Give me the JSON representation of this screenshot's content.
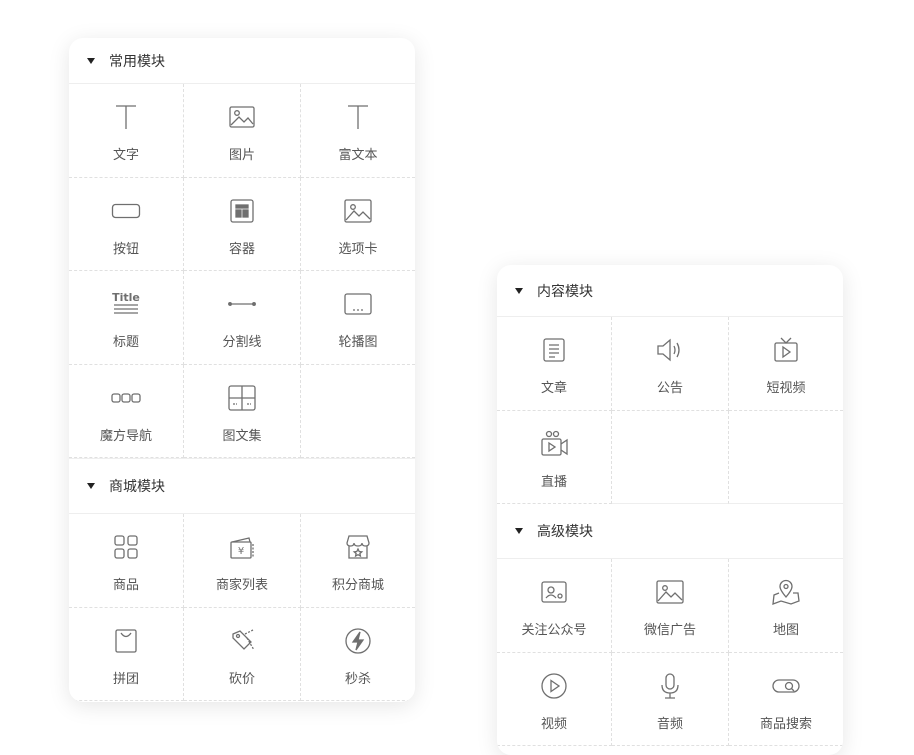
{
  "left_panel": {
    "sections": [
      {
        "title": "常用模块",
        "items": [
          {
            "label": "文字",
            "icon": "text-icon"
          },
          {
            "label": "图片",
            "icon": "image-icon"
          },
          {
            "label": "富文本",
            "icon": "richtext-icon"
          },
          {
            "label": "按钮",
            "icon": "button-icon"
          },
          {
            "label": "容器",
            "icon": "container-icon"
          },
          {
            "label": "选项卡",
            "icon": "tabs-icon"
          },
          {
            "label": "标题",
            "icon": "title-icon",
            "glyph": "Title"
          },
          {
            "label": "分割线",
            "icon": "divider-icon"
          },
          {
            "label": "轮播图",
            "icon": "carousel-icon"
          },
          {
            "label": "魔方导航",
            "icon": "cube-nav-icon"
          },
          {
            "label": "图文集",
            "icon": "gallery-icon"
          }
        ]
      },
      {
        "title": "商城模块",
        "items": [
          {
            "label": "商品",
            "icon": "grid-icon"
          },
          {
            "label": "商家列表",
            "icon": "merchant-list-icon",
            "glyph": "¥"
          },
          {
            "label": "积分商城",
            "icon": "store-icon"
          },
          {
            "label": "拼团",
            "icon": "bag-icon"
          },
          {
            "label": "砍价",
            "icon": "bargain-tag-icon"
          },
          {
            "label": "秒杀",
            "icon": "flash-icon"
          }
        ]
      }
    ]
  },
  "right_panel": {
    "sections": [
      {
        "title": "内容模块",
        "items": [
          {
            "label": "文章",
            "icon": "article-icon"
          },
          {
            "label": "公告",
            "icon": "speaker-icon"
          },
          {
            "label": "短视频",
            "icon": "tv-play-icon"
          },
          {
            "label": "直播",
            "icon": "live-camera-icon"
          }
        ]
      },
      {
        "title": "高级模块",
        "items": [
          {
            "label": "关注公众号",
            "icon": "follow-account-icon"
          },
          {
            "label": "微信广告",
            "icon": "wechat-ad-icon"
          },
          {
            "label": "地图",
            "icon": "map-icon"
          },
          {
            "label": "视频",
            "icon": "video-play-icon"
          },
          {
            "label": "音频",
            "icon": "microphone-icon"
          },
          {
            "label": "商品搜索",
            "icon": "search-toggle-icon"
          }
        ]
      }
    ]
  },
  "colors": {
    "icon_stroke": "#6f6f6f",
    "label_text": "#555555",
    "header_text": "#333333",
    "divider": "#e0e0e0"
  }
}
